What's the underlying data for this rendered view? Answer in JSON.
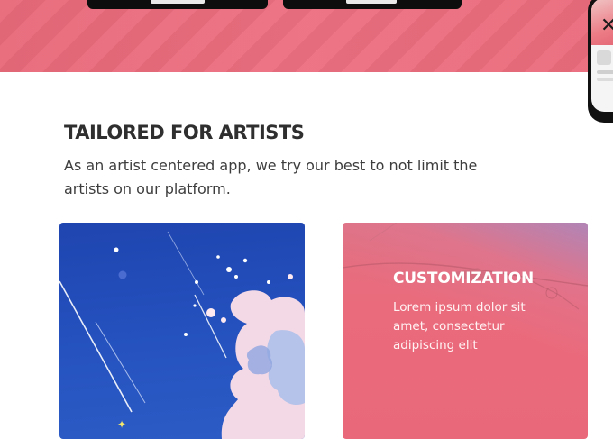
{
  "section": {
    "title": "TAILORED FOR ARTISTS",
    "description": "As an artist centered app, we try our best to not limit the artists on our platform."
  },
  "cards": [
    {
      "name": "artwork-card",
      "icon": "paint-splash-artwork"
    },
    {
      "name": "customization-card",
      "title": "CUSTOMIZATION",
      "text": "Lorem ipsum dolor sit amet, consectetur adipiscing elit"
    }
  ],
  "colors": {
    "hero_pink": "#ea6b7c",
    "card_blue": "#2451be",
    "heading": "#2f2f2f",
    "store_button": "#0d0d0d"
  },
  "hero": {
    "buttons": [
      {
        "icon": "google-play-icon"
      },
      {
        "icon": "app-store-icon"
      }
    ],
    "phone": {
      "icon": "phone-mockup"
    }
  }
}
